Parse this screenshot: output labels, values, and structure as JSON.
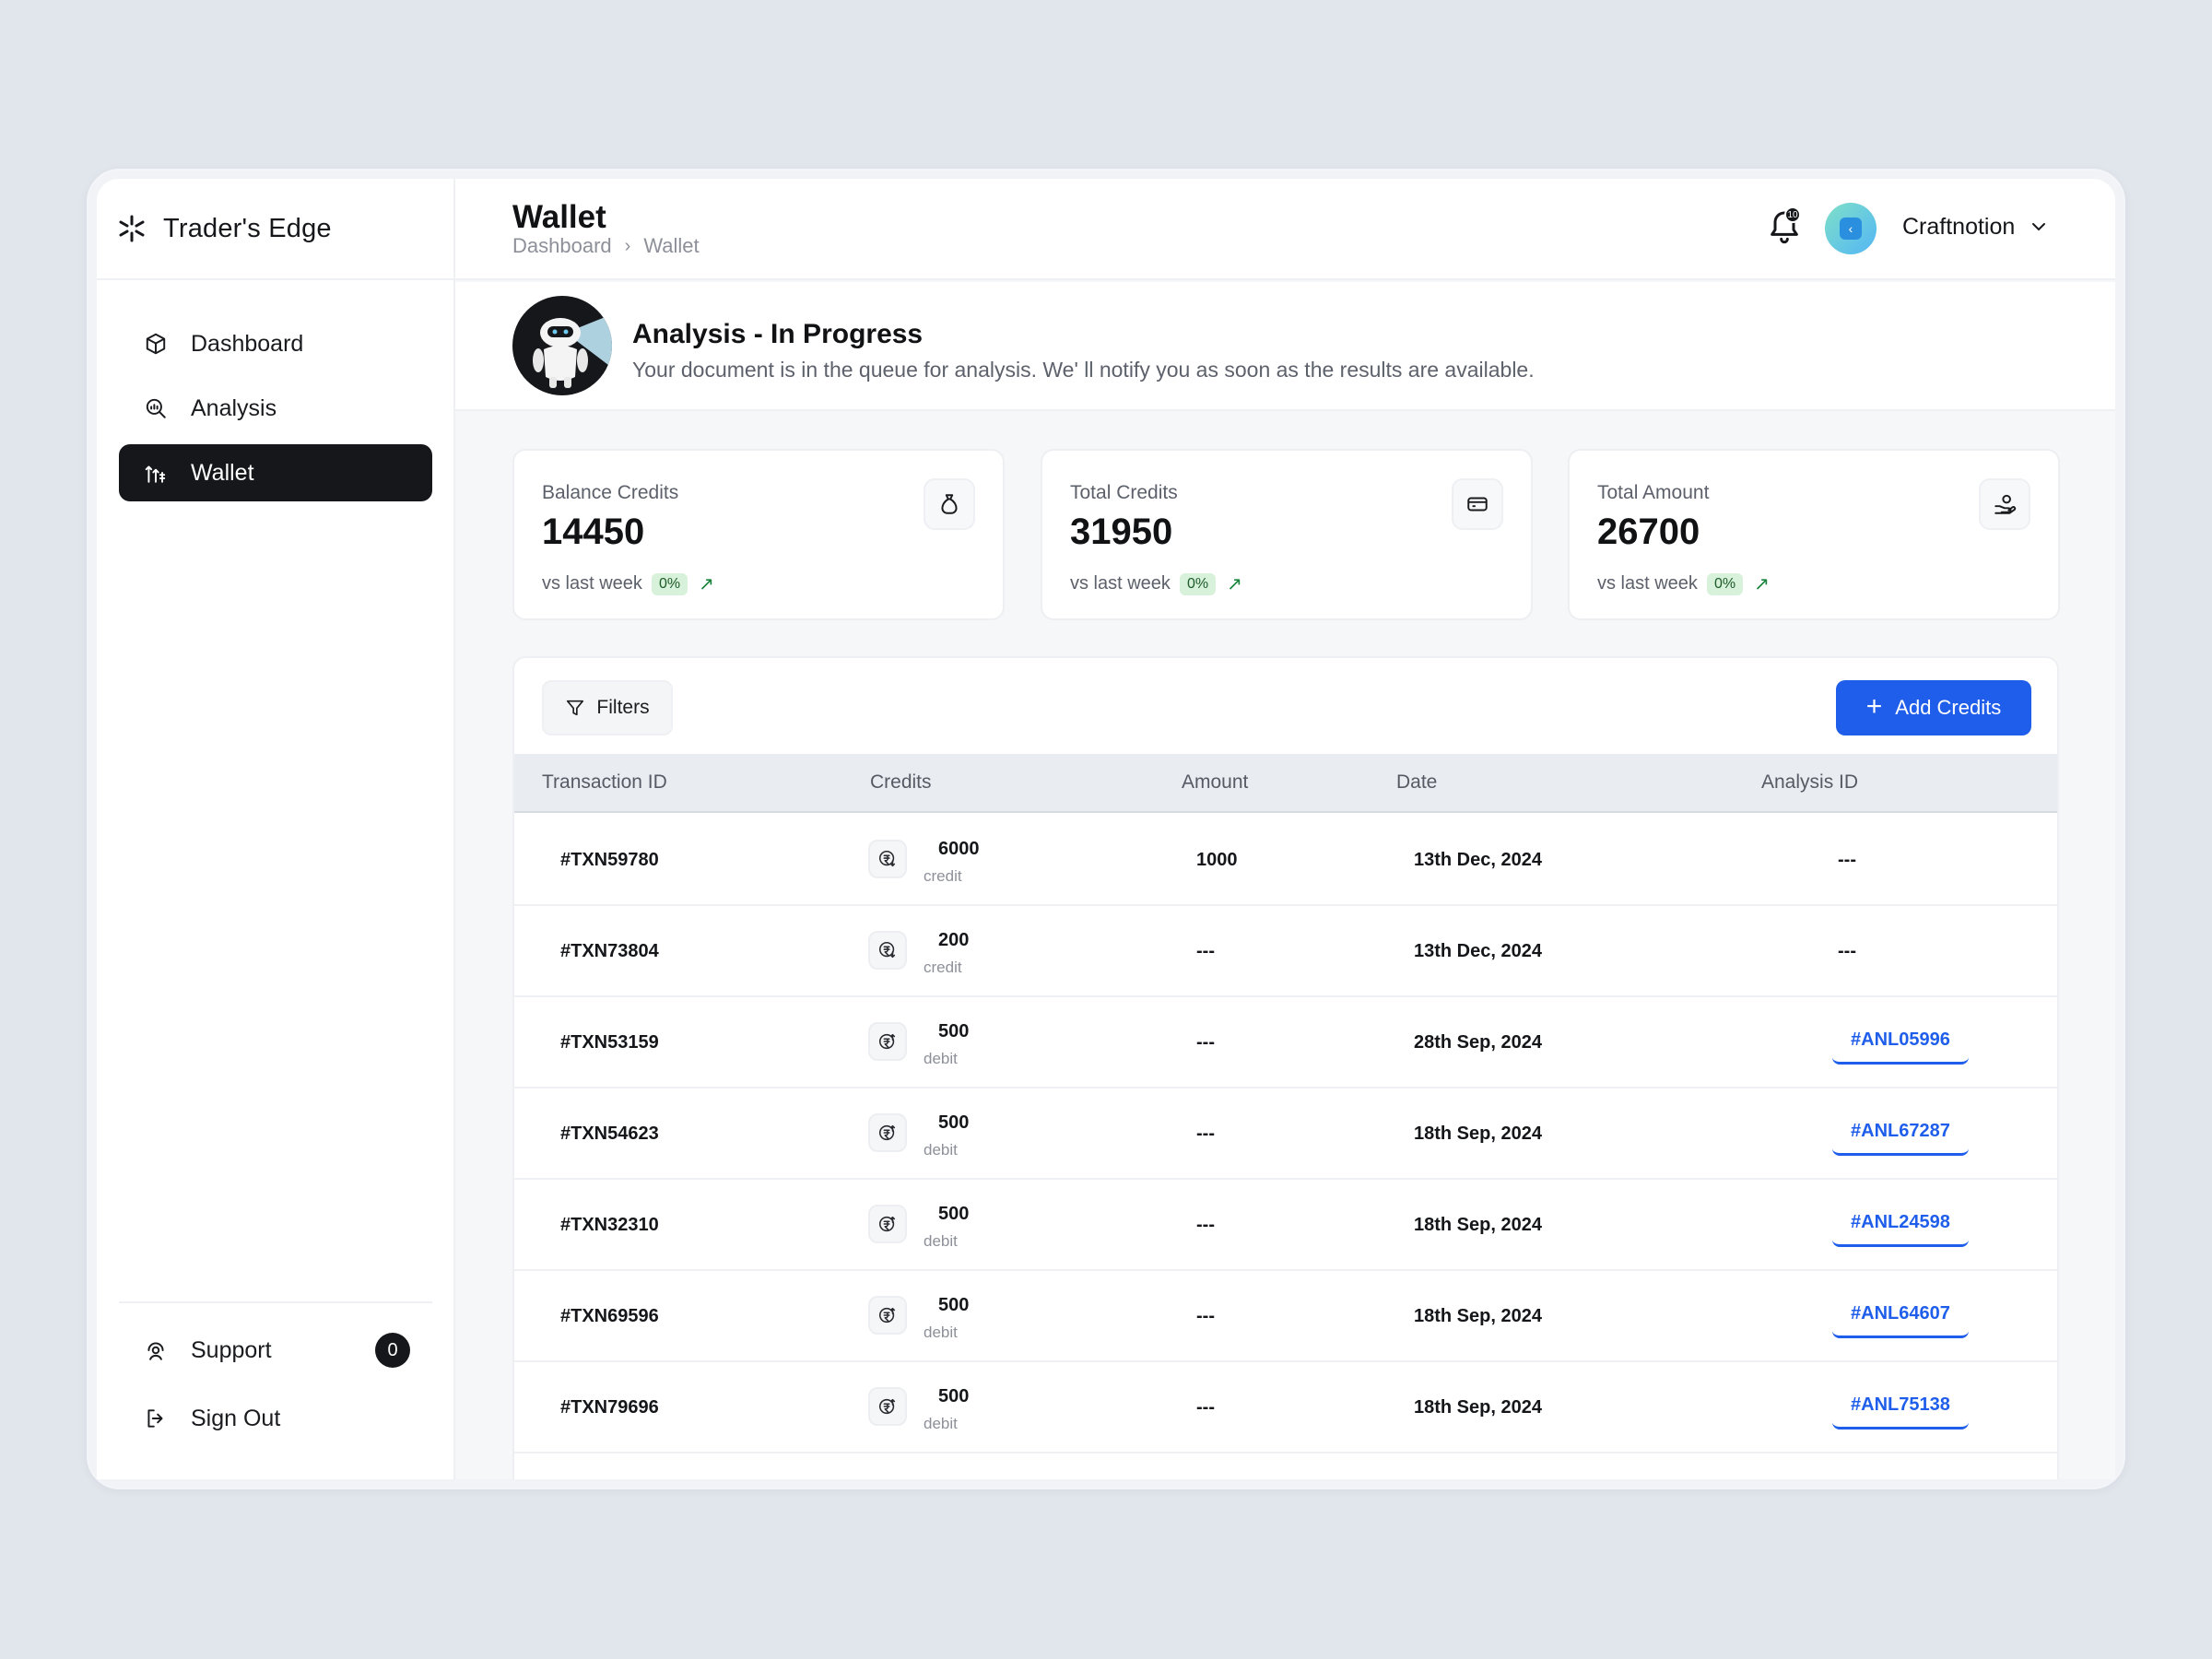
{
  "brand": {
    "name": "Trader's Edge"
  },
  "nav": [
    {
      "label": "Dashboard",
      "icon": "cube-icon",
      "active": false
    },
    {
      "label": "Analysis",
      "icon": "magnifier-chart-icon",
      "active": false
    },
    {
      "label": "Wallet",
      "icon": "wallet-transfer-icon",
      "active": true
    }
  ],
  "sidebar_bottom": {
    "support_label": "Support",
    "support_count": "0",
    "signout_label": "Sign Out"
  },
  "header": {
    "title": "Wallet",
    "breadcrumb": [
      "Dashboard",
      "Wallet"
    ],
    "notification_count": "10",
    "user_name": "Craftnotion"
  },
  "banner": {
    "title": "Analysis - In Progress",
    "text": "Your document is in the queue for analysis. We' ll notify you as soon as the results are available."
  },
  "stats": [
    {
      "label": "Balance Credits",
      "value": "14450",
      "foot": "vs last week",
      "pct": "0%",
      "icon": "money-bag-icon"
    },
    {
      "label": "Total Credits",
      "value": "31950",
      "foot": "vs last week",
      "pct": "0%",
      "icon": "card-icon"
    },
    {
      "label": "Total Amount",
      "value": "26700",
      "foot": "vs last week",
      "pct": "0%",
      "icon": "hand-coin-icon"
    }
  ],
  "toolbar": {
    "filters_label": "Filters",
    "add_label": "Add Credits"
  },
  "table": {
    "columns": [
      "Transaction ID",
      "Credits",
      "Amount",
      "Date",
      "Analysis ID"
    ],
    "rows": [
      {
        "txn": "#TXN59780",
        "credits": "6000",
        "type": "credit",
        "amount": "1000",
        "date": "13th Dec, 2024",
        "analysis": "---",
        "link": false
      },
      {
        "txn": "#TXN73804",
        "credits": "200",
        "type": "credit",
        "amount": "---",
        "date": "13th Dec, 2024",
        "analysis": "---",
        "link": false
      },
      {
        "txn": "#TXN53159",
        "credits": "500",
        "type": "debit",
        "amount": "---",
        "date": "28th Sep, 2024",
        "analysis": "#ANL05996",
        "link": true
      },
      {
        "txn": "#TXN54623",
        "credits": "500",
        "type": "debit",
        "amount": "---",
        "date": "18th Sep, 2024",
        "analysis": "#ANL67287",
        "link": true
      },
      {
        "txn": "#TXN32310",
        "credits": "500",
        "type": "debit",
        "amount": "---",
        "date": "18th Sep, 2024",
        "analysis": "#ANL24598",
        "link": true
      },
      {
        "txn": "#TXN69596",
        "credits": "500",
        "type": "debit",
        "amount": "---",
        "date": "18th Sep, 2024",
        "analysis": "#ANL64607",
        "link": true
      },
      {
        "txn": "#TXN79696",
        "credits": "500",
        "type": "debit",
        "amount": "---",
        "date": "18th Sep, 2024",
        "analysis": "#ANL75138",
        "link": true
      }
    ]
  }
}
